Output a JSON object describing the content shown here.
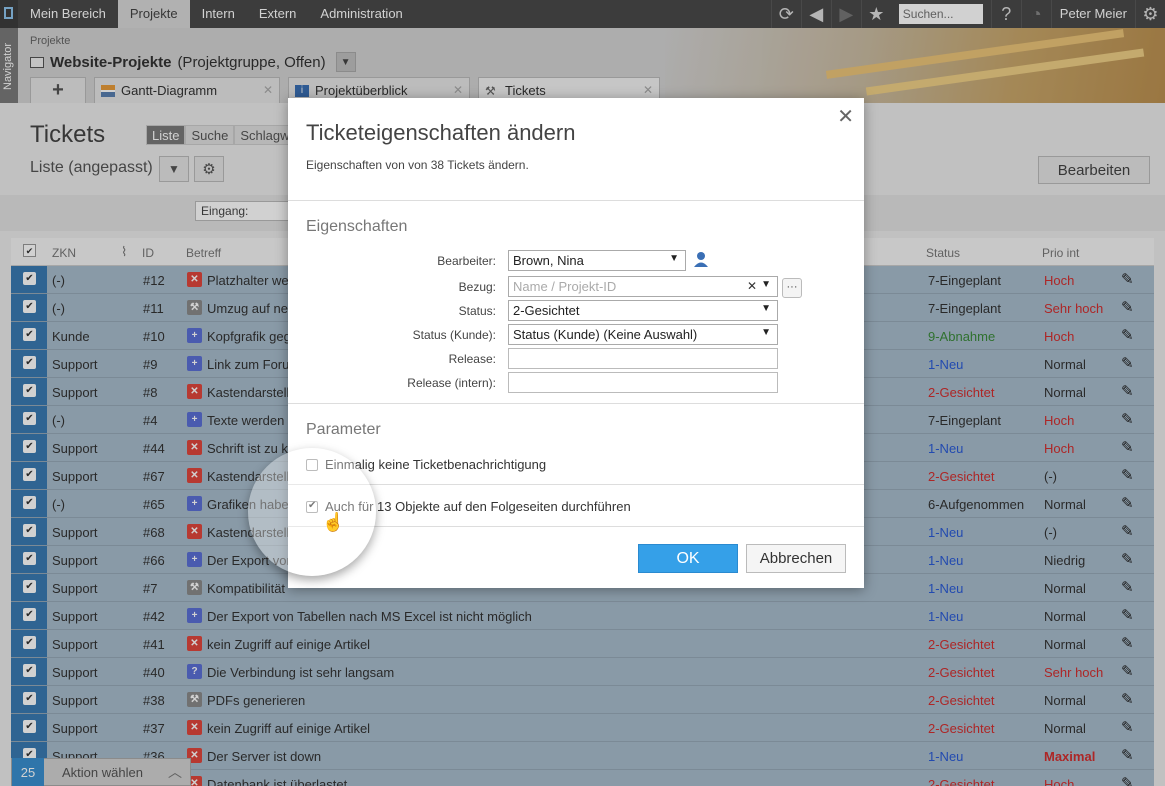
{
  "topnav": {
    "menu": [
      "Mein Bereich",
      "Projekte",
      "Intern",
      "Extern",
      "Administration"
    ],
    "active": "Projekte",
    "search_placeholder": "Suchen...",
    "help": "?",
    "user": "Peter Meier"
  },
  "navigator": "Navigator",
  "header": {
    "breadcrumb": "Projekte",
    "title": "Website-Projekte",
    "subtitle": "(Projektgruppe, Offen)",
    "tabs": [
      {
        "label": "+"
      },
      {
        "label": "Gantt-Diagramm"
      },
      {
        "label": "Projektüberblick"
      },
      {
        "label": "Tickets"
      }
    ]
  },
  "page": {
    "title": "Tickets",
    "view_tabs": [
      "Liste",
      "Suche",
      "Schlagwo"
    ],
    "list_name": "Liste (angepasst)",
    "edit_button": "Bearbeiten",
    "filter_eingang": "Eingang:"
  },
  "table": {
    "headers": {
      "zkn": "ZKN",
      "id": "ID",
      "betreff": "Betreff",
      "status": "Status",
      "prio": "Prio int"
    },
    "rows": [
      {
        "zkn": "(-)",
        "id": "#12",
        "icon": "bug",
        "betreff": "Platzhalter wer",
        "status": "7-Eingeplant",
        "prio": "Hoch"
      },
      {
        "zkn": "(-)",
        "id": "#11",
        "icon": "tool",
        "betreff": "Umzug auf neu",
        "status": "7-Eingeplant",
        "prio": "Sehr hoch"
      },
      {
        "zkn": "Kunde",
        "id": "#10",
        "icon": "plus",
        "betreff": "Kopfgrafik geg",
        "status": "9-Abnahme",
        "prio": "Hoch"
      },
      {
        "zkn": "Support",
        "id": "#9",
        "icon": "plus",
        "betreff": "Link zum Foru",
        "status": "1-Neu",
        "prio": "Normal"
      },
      {
        "zkn": "Support",
        "id": "#8",
        "icon": "bug",
        "betreff": "Kastendarstell",
        "status": "2-Gesichtet",
        "prio": "Normal"
      },
      {
        "zkn": "(-)",
        "id": "#4",
        "icon": "plus",
        "betreff": "Texte werden",
        "status": "7-Eingeplant",
        "prio": "Hoch"
      },
      {
        "zkn": "Support",
        "id": "#44",
        "icon": "bug",
        "betreff": "Schrift ist zu kl",
        "status": "1-Neu",
        "prio": "Hoch"
      },
      {
        "zkn": "Support",
        "id": "#67",
        "icon": "bug",
        "betreff": "Kastendarstell",
        "status": "2-Gesichtet",
        "prio": "(-)"
      },
      {
        "zkn": "(-)",
        "id": "#65",
        "icon": "plus",
        "betreff": "Grafiken haben",
        "status": "6-Aufgenommen",
        "prio": "Normal"
      },
      {
        "zkn": "Support",
        "id": "#68",
        "icon": "bug",
        "betreff": "Kastendarstell",
        "status": "1-Neu",
        "prio": "(-)"
      },
      {
        "zkn": "Support",
        "id": "#66",
        "icon": "plus",
        "betreff": "Der Export von",
        "status": "1-Neu",
        "prio": "Niedrig"
      },
      {
        "zkn": "Support",
        "id": "#7",
        "icon": "tool",
        "betreff": "Kompatibilität",
        "status": "1-Neu",
        "prio": "Normal"
      },
      {
        "zkn": "Support",
        "id": "#42",
        "icon": "plus",
        "betreff": "Der Export von Tabellen nach MS Excel ist nicht möglich",
        "status": "1-Neu",
        "prio": "Normal"
      },
      {
        "zkn": "Support",
        "id": "#41",
        "icon": "bug",
        "betreff": "kein Zugriff auf einige Artikel",
        "status": "2-Gesichtet",
        "prio": "Normal"
      },
      {
        "zkn": "Support",
        "id": "#40",
        "icon": "question",
        "betreff": "Die Verbindung ist sehr langsam",
        "status": "2-Gesichtet",
        "prio": "Sehr hoch"
      },
      {
        "zkn": "Support",
        "id": "#38",
        "icon": "tool",
        "betreff": "PDFs generieren",
        "status": "2-Gesichtet",
        "prio": "Normal"
      },
      {
        "zkn": "Support",
        "id": "#37",
        "icon": "bug",
        "betreff": "kein Zugriff auf einige Artikel",
        "status": "2-Gesichtet",
        "prio": "Normal"
      },
      {
        "zkn": "Support",
        "id": "#36",
        "icon": "bug",
        "betreff": "Der Server ist down",
        "status": "1-Neu",
        "prio": "Maximal"
      },
      {
        "zkn": "",
        "id": "",
        "icon": "bug",
        "betreff": "Datenbank ist überlastet",
        "status": "2-Gesichtet",
        "prio": "Hoch"
      }
    ]
  },
  "actionbar": {
    "count": "25",
    "label": "Aktion wählen"
  },
  "dialog": {
    "title": "Ticketeigenschaften ändern",
    "description": "Eigenschaften von von 38 Tickets ändern.",
    "section_properties": "Eigenschaften",
    "fields": {
      "bearbeiter_label": "Bearbeiter:",
      "bearbeiter_value": "Brown, Nina",
      "bezug_label": "Bezug:",
      "bezug_placeholder": "Name / Projekt-ID",
      "status_label": "Status:",
      "status_value": "2-Gesichtet",
      "status_kunde_label": "Status (Kunde):",
      "status_kunde_value": "Status (Kunde) (Keine Auswahl)",
      "release_label": "Release:",
      "release_intern_label": "Release (intern):"
    },
    "section_parameters": "Parameter",
    "checkbox1": {
      "label": "Einmalig keine Ticketbenachrichtigung",
      "checked": false
    },
    "checkbox2": {
      "label": "Auch für 13 Objekte auf den Folgeseiten durchführen",
      "checked": true
    },
    "ok": "OK",
    "cancel": "Abbrechen"
  },
  "colors": {
    "accent": "#35a0e8",
    "status_blue": "#2a5bd7",
    "status_red": "#d32f2f",
    "status_green": "#3a8a3a",
    "prio_red": "#d32f2f"
  }
}
